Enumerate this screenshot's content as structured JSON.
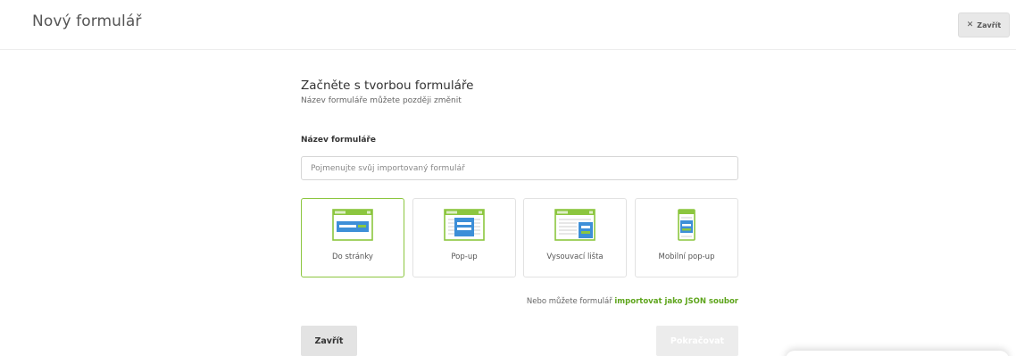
{
  "header": {
    "title": "Nový formulář",
    "close_label": "Zavřít",
    "close_icon": "close-icon"
  },
  "intro": {
    "heading": "Začněte s tvorbou formuláře",
    "subheading": "Název formuláře můžete později změnit"
  },
  "form_name": {
    "label": "Název formuláře",
    "value": "",
    "placeholder": "Pojmenujte svůj importovaný formulář"
  },
  "form_types": [
    {
      "label": "Do stránky",
      "icon": "inline-form-icon",
      "selected": true
    },
    {
      "label": "Pop-up",
      "icon": "popup-form-icon",
      "selected": false
    },
    {
      "label": "Vysouvací lišta",
      "icon": "slide-in-bar-icon",
      "selected": false
    },
    {
      "label": "Mobilní pop-up",
      "icon": "mobile-popup-icon",
      "selected": false
    }
  ],
  "import": {
    "prefix": "Nebo můžete formulář",
    "link": "importovat jako JSON soubor"
  },
  "footer": {
    "close_label": "Zavřít",
    "continue_label": "Pokračovat",
    "continue_disabled": true
  },
  "colors": {
    "accent_green": "#8cc63f",
    "link_green": "#5ea51c",
    "thumb_blue": "#3d8fd8"
  }
}
